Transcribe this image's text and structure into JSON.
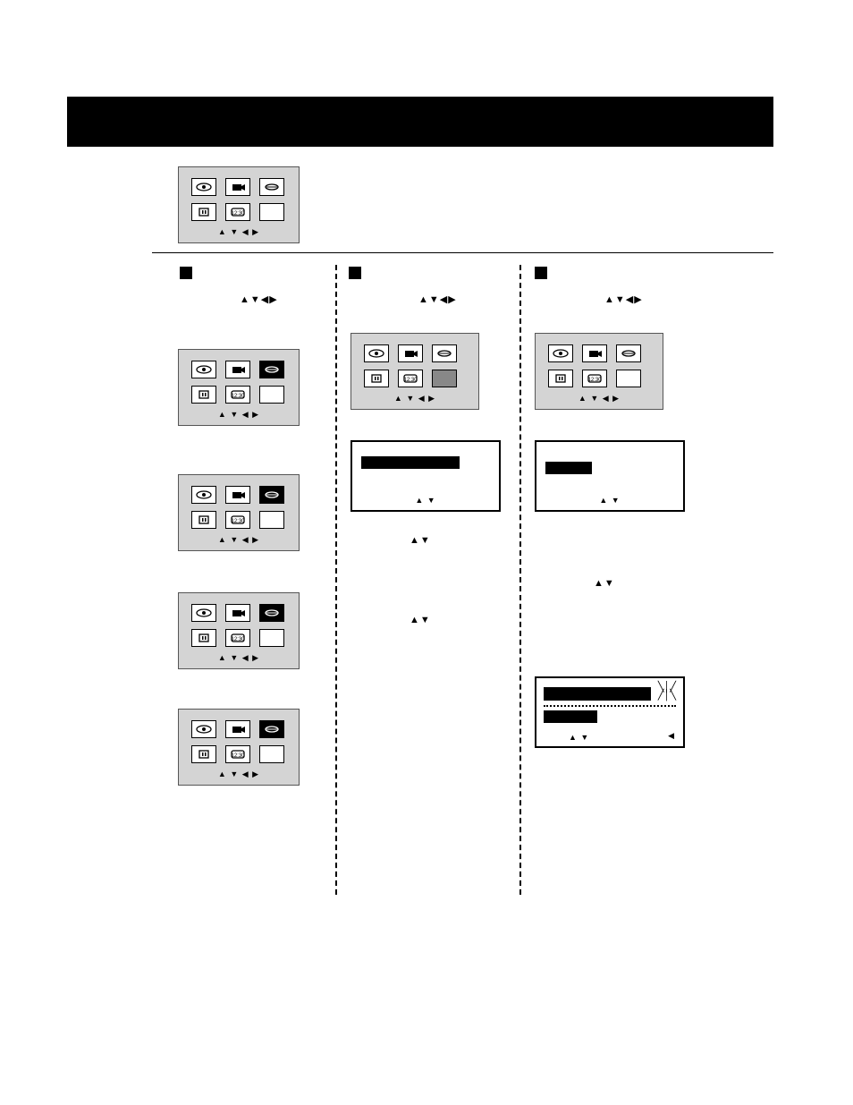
{
  "domain": "Document",
  "panels": {
    "top": {
      "arrows": "▲ ▼ ◀ ▶"
    },
    "col1": [
      {
        "arrows": "▲ ▼ ◀ ▶",
        "highlight": 2
      },
      {
        "arrows": "▲ ▼ ◀ ▶",
        "highlight": 2
      },
      {
        "arrows": "▲ ▼ ◀ ▶",
        "highlight": 2
      },
      {
        "arrows": "▲ ▼ ◀ ▶",
        "highlight": 2
      }
    ],
    "col2": {
      "arrows": "▲ ▼ ◀ ▶",
      "highlight": 5
    },
    "col3": {
      "arrows": "▲ ▼ ◀ ▶",
      "highlight": null
    }
  },
  "subpanels": {
    "col2": {
      "arrows": "▲ ▼"
    },
    "col3": {
      "arrows": "▲ ▼"
    }
  },
  "clockpanel": {
    "arrows": "▲ ▼",
    "left": "◀"
  },
  "arrow_words": {
    "c1_top": "▲▼◀▶",
    "c2_top": "▲▼◀▶",
    "c3_top": "▲▼◀▶",
    "c2_mid": "▲▼",
    "c2_low": "▲▼",
    "c3_mid": "▲▼"
  }
}
